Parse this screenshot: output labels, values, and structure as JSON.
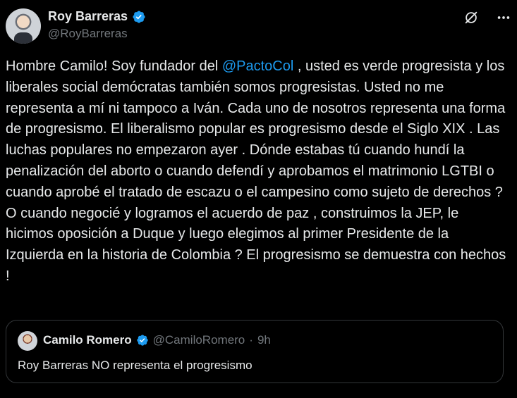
{
  "author": {
    "name": "Roy Barreras",
    "handle": "@RoyBarreras"
  },
  "icons": {
    "verified": "verified-badge-icon",
    "grok": "grok-icon",
    "more": "more-options-icon"
  },
  "colors": {
    "accent": "#1d9bf0",
    "background": "#000000",
    "muted": "#71767b"
  },
  "tweet": {
    "part1": "Hombre Camilo! Soy fundador del ",
    "mention": "@PactoCol",
    "part2": " , usted es verde progresista y los liberales social demócratas también somos progresistas. Usted no me representa a mí ni tampoco a Iván. Cada uno de nosotros representa  una forma de progresismo. El liberalismo popular es progresismo desde el Siglo XIX . Las luchas populares no empezaron ayer . Dónde estabas tú cuando hundí la penalización del aborto o cuando defendí y aprobamos el matrimonio LGTBI o cuando aprobé el tratado de escazu o el campesino como sujeto de derechos ? O cuando negocié y logramos el acuerdo de paz , construimos la JEP, le hicimos oposición a Duque y luego elegimos al primer Presidente de la Izquierda en la historia de Colombia ? El progresismo se demuestra con hechos !"
  },
  "quote": {
    "name": "Camilo Romero",
    "handle": "@CamiloRomero",
    "separator": "·",
    "time": "9h",
    "text": "Roy Barreras NO representa el progresismo"
  }
}
